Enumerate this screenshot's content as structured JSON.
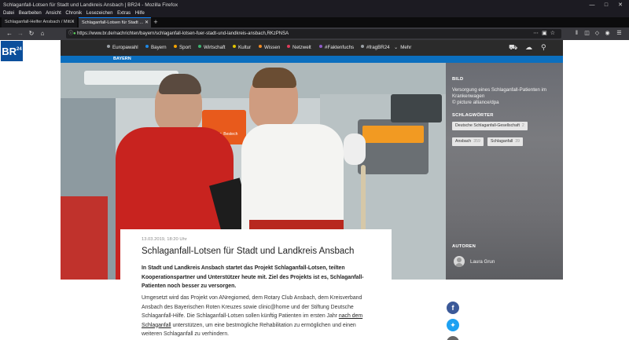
{
  "browser": {
    "window_title": "Schlaganfall-Lotsen für Stadt und Landkreis Ansbach | BR24 - Mozilla Firefox",
    "menu": [
      "Datei",
      "Bearbeiten",
      "Ansicht",
      "Chronik",
      "Lesezeichen",
      "Extras",
      "Hilfe"
    ],
    "tabs": [
      {
        "label": "Schlaganfall-Helfer Ansbach / Mitt...",
        "active": false
      },
      {
        "label": "Schlaganfall-Lotsen für Stadt ...",
        "active": true
      }
    ],
    "url": "https://www.br.de/nachrichten/bayern/schlaganfall-lotsen-fuer-stadt-und-landkreis-ansbach,RKzPNSA"
  },
  "site": {
    "logo": "BR",
    "logo_sup": "24",
    "nav": [
      {
        "label": "Europawahl",
        "color": "#9aa0a6"
      },
      {
        "label": "Bayern",
        "color": "#1e88e5"
      },
      {
        "label": "Sport",
        "color": "#f4a300"
      },
      {
        "label": "Wirtschaft",
        "color": "#3cb371"
      },
      {
        "label": "Kultur",
        "color": "#e0c400"
      },
      {
        "label": "Wissen",
        "color": "#f08a24"
      },
      {
        "label": "Netzwelt",
        "color": "#e03c5a"
      },
      {
        "label": "#Faktenfuchs",
        "color": "#8e5bc8"
      },
      {
        "label": "#fragBR24",
        "color": "#9aa0a6"
      },
      {
        "label": "Mehr",
        "color": ""
      }
    ],
    "subnav": "BAYERN"
  },
  "sidebar": {
    "bild_heading": "BILD",
    "bild_caption": "Versorgung eines Schlaganfall-Patienten im Krankenwagen",
    "bild_credit": "© picture alliance/dpa",
    "tags_heading": "SCHLAGWÖRTER",
    "tags": [
      {
        "label": "Deutsche Schlaganfall-Gesellschaft",
        "count": "2"
      },
      {
        "label": "Ansbach",
        "count": "359"
      },
      {
        "label": "Schlaganfall",
        "count": "39"
      }
    ],
    "authors_heading": "AUTOREN",
    "author": "Laura Grun"
  },
  "article": {
    "date": "13.03.2019, 18:20 Uhr",
    "headline": "Schlaganfall-Lotsen für Stadt und Landkreis Ansbach",
    "lead": "In Stadt und Landkreis Ansbach startet das Projekt Schlaganfall-Lotsen, teilten Kooperationspartner und Unterstützer heute mit. Ziel des Projekts ist es, Schlaganfall-Patienten noch besser zu versorgen.",
    "body_1": "Umgesetzt wird das Projekt von ANregiomed, dem Rotary Club Ansbach, dem Kreisverband Ansbach des Bayerischen Roten Kreuzes sowie clinic@home und der Stiftung Deutsche Schlaganfall-Hilfe. Die Schlaganfall-Lotsen sollen künftig Patienten im ersten Jahr ",
    "body_link": "nach dem Schlaganfall",
    "body_2": " unterstützen, um eine bestmögliche Rehabilitation zu ermöglichen und einen weiteren Schlaganfall zu verhindern."
  },
  "hero_labels": {
    "box_text": "Einlag. Bestech"
  }
}
